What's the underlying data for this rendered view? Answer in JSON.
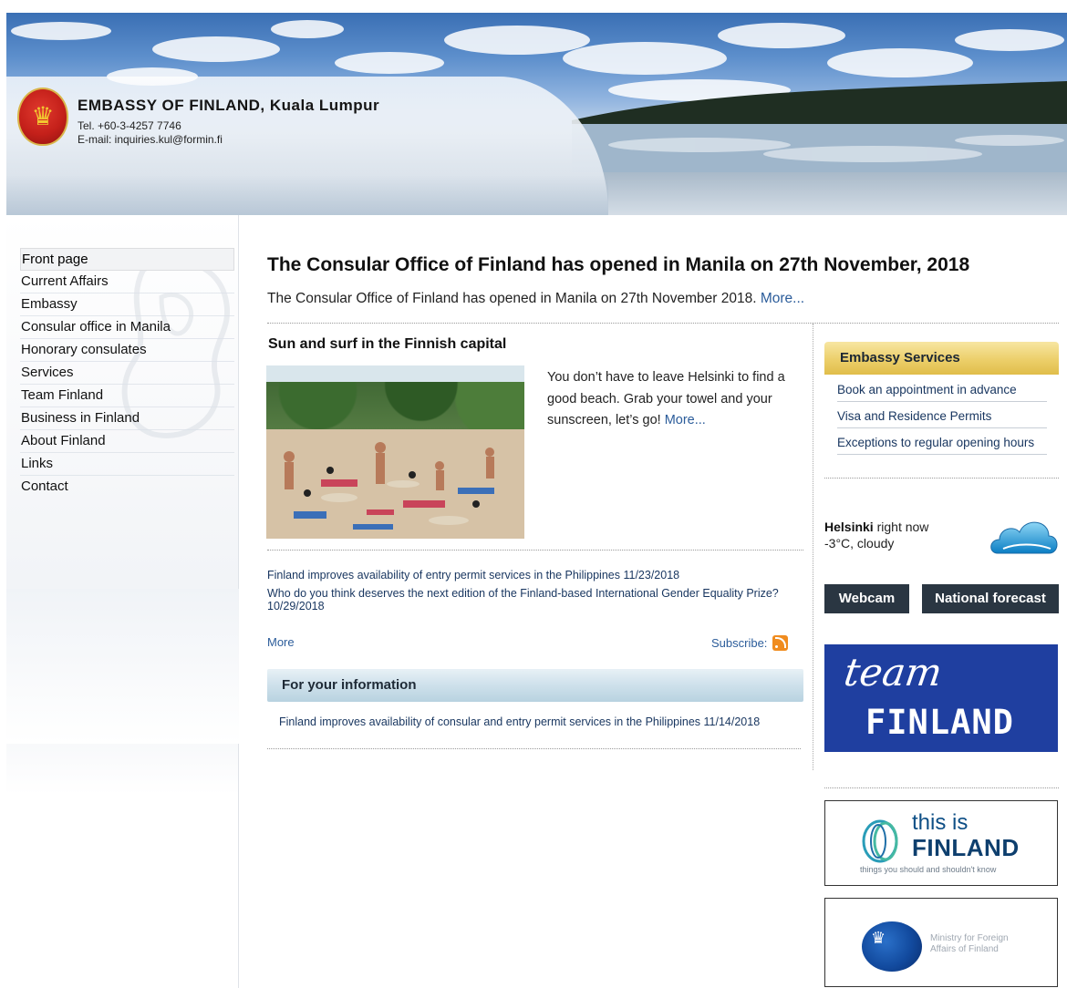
{
  "header": {
    "title": "EMBASSY OF FINLAND, Kuala Lumpur",
    "tel": "Tel. +60-3-4257 7746",
    "email": "E-mail: inquiries.kul@formin.fi"
  },
  "nav": {
    "items": [
      {
        "label": "Front page",
        "active": true
      },
      {
        "label": "Current Affairs"
      },
      {
        "label": "Embassy"
      },
      {
        "label": "Consular office in Manila"
      },
      {
        "label": "Honorary consulates"
      },
      {
        "label": "Services"
      },
      {
        "label": "Team Finland"
      },
      {
        "label": "Business in Finland"
      },
      {
        "label": "About Finland"
      },
      {
        "label": "Links"
      },
      {
        "label": "Contact"
      }
    ]
  },
  "main": {
    "headline": "The Consular Office of Finland has opened in Manila on 27th November, 2018",
    "lead": "The Consular Office of Finland has opened in Manila on 27th November 2018.",
    "lead_more": "More...",
    "story": {
      "title": "Sun and surf in the Finnish capital",
      "text": "You don’t have to leave Helsinki to find a good beach. Grab your towel and your sunscreen, let’s go!",
      "more": "More..."
    },
    "news": [
      {
        "text": "Finland improves availability of entry permit services in the Philippines",
        "date": "11/23/2018"
      },
      {
        "text": "Who do you think deserves the next edition of the Finland-based International Gender Equality Prize?",
        "date": "10/29/2018"
      }
    ],
    "news_more": "More",
    "subscribe_label": "Subscribe:",
    "fyi": {
      "title": "For your information",
      "item_text": "Finland improves availability of consular and entry permit services in the Philippines",
      "item_date": "11/14/2018"
    }
  },
  "sidebar": {
    "services_title": "Embassy Services",
    "services": [
      "Book an appointment in advance",
      "Visa and Residence Permits",
      "Exceptions to regular opening hours"
    ],
    "weather": {
      "city": "Helsinki",
      "suffix": "right now",
      "conditions": "-3°C, cloudy",
      "icon": "cloud-icon"
    },
    "webcam_label": "Webcam",
    "forecast_label": "National forecast",
    "team_finland": {
      "script": "team",
      "word": "FINLAND"
    },
    "this_is_finland": {
      "line1": "this is",
      "line2": "FINLAND",
      "tagline": "things you should and shouldn't know"
    },
    "ministry": {
      "line1": "Ministry for Foreign",
      "line2": "Affairs of Finland"
    }
  },
  "colors": {
    "link": "#17355f",
    "services_header": "#eccf6a",
    "dark_button": "#2a3642",
    "team_finland_blue": "#1f3fa0",
    "rss_orange": "#f08c1f"
  }
}
